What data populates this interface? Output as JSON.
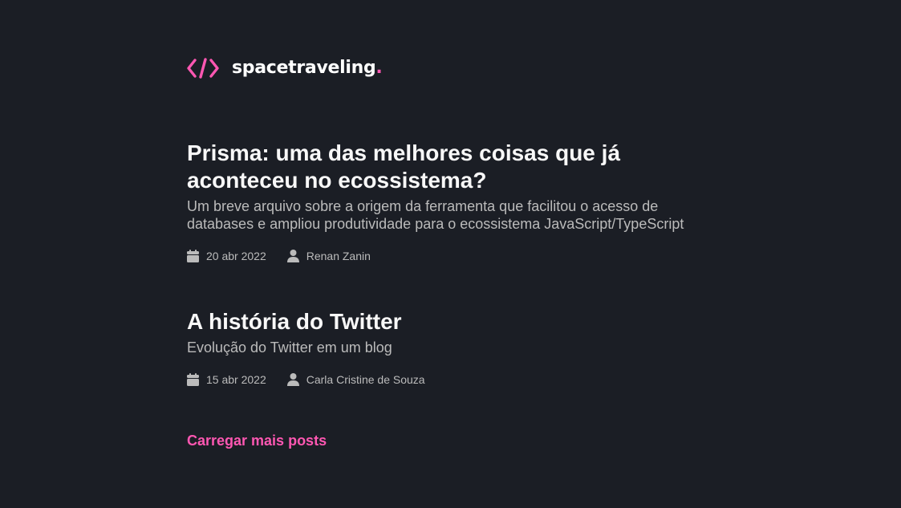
{
  "header": {
    "logo_icon": "code-brackets-icon",
    "logo_text": "spacetraveling",
    "logo_dot": ".",
    "accent_color": "#ff57b2"
  },
  "posts": [
    {
      "title": "Prisma: uma das melhores coisas que já aconteceu no ecossistema?",
      "subtitle": "Um breve arquivo sobre a origem da ferramenta que facilitou o acesso de databases e ampliou produtividade para o ecossistema JavaScript/TypeScript",
      "date": "20 abr 2022",
      "author": "Renan Zanin",
      "date_icon": "calendar-icon",
      "author_icon": "user-icon"
    },
    {
      "title": "A história do Twitter",
      "subtitle": "Evolução do Twitter em um blog",
      "date": "15 abr 2022",
      "author": "Carla Cristine de Souza",
      "date_icon": "calendar-icon",
      "author_icon": "user-icon"
    }
  ],
  "load_more_label": "Carregar mais posts",
  "colors": {
    "background": "#1b1e25",
    "heading": "#f8f8f8",
    "body_text": "#bbbbbb",
    "accent": "#ff57b2"
  }
}
